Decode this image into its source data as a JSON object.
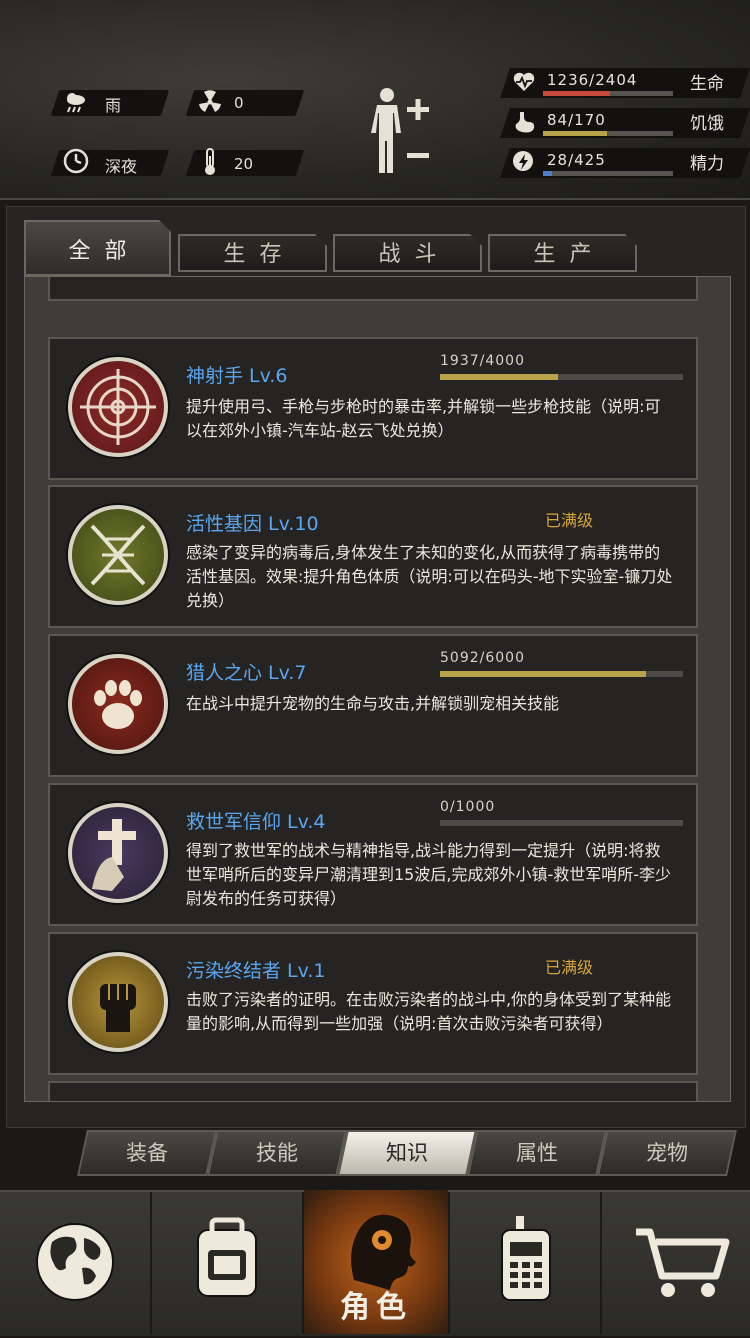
{
  "environment": {
    "weather": "雨",
    "radiation": "0",
    "time_of_day": "深夜",
    "temperature": "20"
  },
  "vitals": [
    {
      "icon": "heart-icon",
      "value": "1236/2404",
      "label": "生命",
      "fraction": 0.514,
      "color": "#c94a3a"
    },
    {
      "icon": "stomach-icon",
      "value": "84/170",
      "label": "饥饿",
      "fraction": 0.494,
      "color": "#b8a34a"
    },
    {
      "icon": "energy-icon",
      "value": "28/425",
      "label": "精力",
      "fraction": 0.066,
      "color": "#4a7fc9"
    }
  ],
  "tabs": [
    "全部",
    "生存",
    "战斗",
    "生产"
  ],
  "skills": [
    {
      "icon": "crosshair-icon",
      "name": "神射手 Lv.6",
      "progress_text": "1937/4000",
      "progress": 0.484,
      "maxed_text": "",
      "desc": "提升使用弓、手枪与步枪时的暴击率,并解锁一些步枪技能（说明:可以在郊外小镇-汽车站-赵云飞处兑换）"
    },
    {
      "icon": "dna-icon",
      "name": "活性基因 Lv.10",
      "progress_text": "",
      "progress": null,
      "maxed_text": "已满级",
      "desc": "感染了变异的病毒后,身体发生了未知的变化,从而获得了病毒携带的活性基因。效果:提升角色体质（说明:可以在码头-地下实验室-镰刀处兑换）"
    },
    {
      "icon": "paw-icon",
      "name": "猎人之心 Lv.7",
      "progress_text": "5092/6000",
      "progress": 0.849,
      "maxed_text": "",
      "desc": "在战斗中提升宠物的生命与攻击,并解锁驯宠相关技能"
    },
    {
      "icon": "cross-prayer-icon",
      "name": "救世军信仰 Lv.4",
      "progress_text": "0/1000",
      "progress": 0.0,
      "maxed_text": "",
      "desc": "得到了救世军的战术与精神指导,战斗能力得到一定提升（说明:将救世军哨所后的变异尸潮清理到15波后,完成郊外小镇-救世军哨所-李少尉发布的任务可获得）"
    },
    {
      "icon": "fist-icon",
      "name": "污染终结者 Lv.1",
      "progress_text": "",
      "progress": null,
      "maxed_text": "已满级",
      "desc": "击败了污染者的证明。在击败污染者的战斗中,你的身体受到了某种能量的影响,从而得到一些加强（说明:首次击败污染者可获得）"
    }
  ],
  "subtabs": [
    "装备",
    "技能",
    "知识",
    "属性",
    "宠物"
  ],
  "nav": {
    "center_label": "角色"
  }
}
